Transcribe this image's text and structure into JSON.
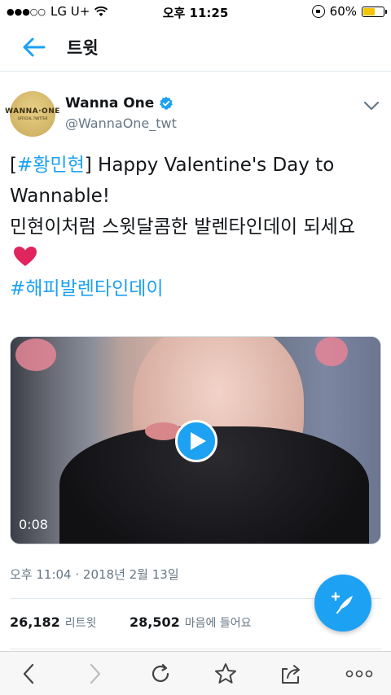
{
  "status_bar": {
    "carrier": "LG U+",
    "time": "오후 11:25",
    "battery_text": "60%",
    "battery_level": 0.6,
    "battery_color": "#f5c400"
  },
  "header": {
    "back_icon": "back-arrow-icon",
    "title": "트윗"
  },
  "tweet": {
    "author_name": "Wanna One",
    "author_handle": "@WannaOne_twt",
    "avatar_logo": "WANNA·ONE",
    "avatar_sub": "OFFICIAL TWITTER",
    "verified": true,
    "text_bracket_open": "[",
    "text_hashtag_1": "#황민현",
    "text_after_hashtag": "] Happy Valentine's Day to Wannable!",
    "text_line_2": "민현이처럼 스윗달콤한 발렌타인데이 되세요",
    "text_hashtag_2": "#해피발렌타인데이",
    "video_duration": "0:08",
    "timestamp": "오후 11:04 · 2018년 2월 13일",
    "retweets_count": "26,182",
    "retweets_label": "리트윗",
    "likes_count": "28,502",
    "likes_label": "마음에 들어요"
  },
  "colors": {
    "accent": "#1da1f2",
    "text": "#14171a",
    "muted": "#657786",
    "heart": "#e0245e"
  },
  "toolbar": {
    "items": [
      "back-icon",
      "forward-icon",
      "reload-icon",
      "bookmark-star-icon",
      "share-icon",
      "more-icon"
    ]
  }
}
